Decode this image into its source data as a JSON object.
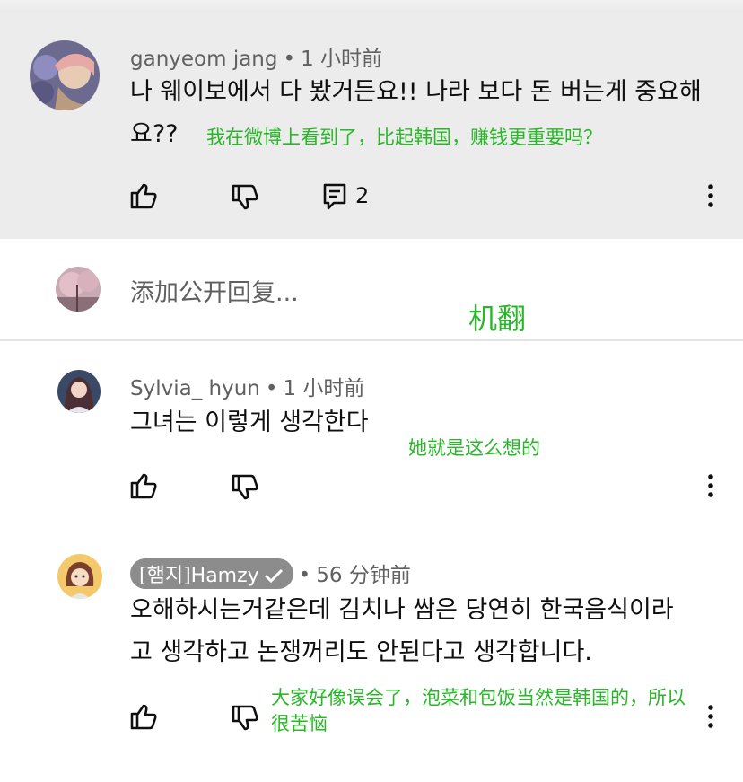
{
  "comments": [
    {
      "author": "ganyeom jang",
      "time": "1 小时前",
      "text_lines": [
        "나 웨이보에서 다 봤거든요!! 나라 보다 돈 버는게 중요해",
        "요??"
      ],
      "translation": "我在微博上看到了，比起韩国，赚钱更重要吗？",
      "reply_count": "2"
    },
    {
      "author": "Sylvia_ hyun",
      "time": "1 小时前",
      "text_lines": [
        "그녀는 이렇게 생각한다"
      ],
      "translation": "她就是这么想的"
    },
    {
      "author": "[햄지]Hamzy",
      "time": "56 分钟前",
      "text_lines": [
        "오해하시는거같은데 김치나 쌈은 당연히 한국음식이라",
        "고 생각하고 논쟁꺼리도 안된다고 생각합니다."
      ],
      "translation_lines": [
        "大家好像误会了，泡菜和包饭当然是韩国的，所以",
        "很苦恼"
      ]
    }
  ],
  "reply_input": {
    "placeholder": "添加公开回复..."
  },
  "annotation": "机翻",
  "separator": "•",
  "colors": {
    "translation": "#27b727",
    "highlight_bg": "#ececec",
    "meta": "#606060"
  },
  "icons": [
    "like-icon",
    "dislike-icon",
    "reply-icon",
    "more-vert-icon",
    "verified-check-icon"
  ]
}
